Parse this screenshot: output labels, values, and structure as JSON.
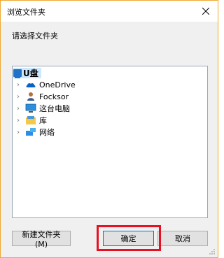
{
  "window": {
    "title": "浏览文件夹",
    "close_label": "×"
  },
  "prompt": "请选择文件夹",
  "tree": {
    "root": {
      "label": "U盘",
      "icon": "usb-drive-icon"
    },
    "items": [
      {
        "label": "OneDrive",
        "icon": "onedrive-cloud-icon"
      },
      {
        "label": "Focksor",
        "icon": "user-folder-icon"
      },
      {
        "label": "这台电脑",
        "icon": "computer-icon"
      },
      {
        "label": "库",
        "icon": "library-icon"
      },
      {
        "label": "网络",
        "icon": "network-icon"
      }
    ],
    "expander": "›"
  },
  "buttons": {
    "new_folder": "新建文件夹(M)",
    "ok": "确定",
    "cancel": "取消"
  },
  "colors": {
    "accent_border": "#f0a830",
    "selection": "#cce8ff",
    "highlight_frame": "#e81123",
    "default_button_border": "#0078d7"
  }
}
